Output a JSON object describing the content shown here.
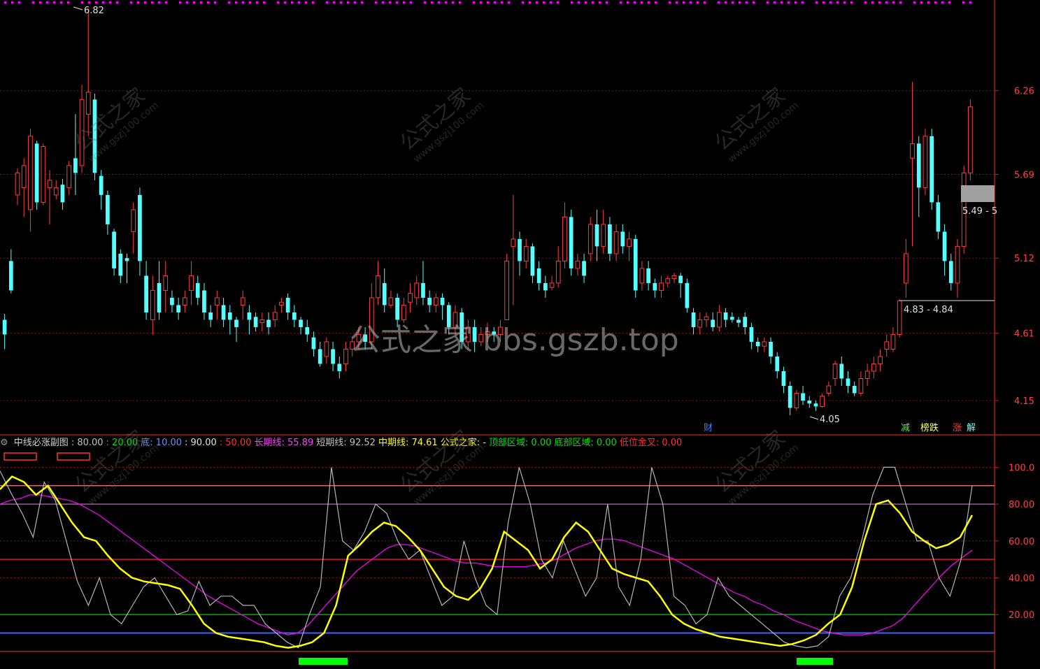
{
  "watermark_main": "公式之家 bbs.gszb.top",
  "watermark_diag": "公式之家",
  "watermark_diag_url": "www.gszj100.com",
  "colors": {
    "up": "#ff3c3c",
    "down": "#54ffff",
    "yellow_line": "#ffff00",
    "magenta_line": "#ff00ff",
    "gray_line": "#b4b4b4",
    "grid_red": "#8a1010"
  },
  "indicator_legend": [
    {
      "text": "中线必涨副图",
      "color": "#d0d0d0"
    },
    {
      "text": ": 80.00",
      "color": "#c0c0c0"
    },
    {
      "text": ": 20.00",
      "color": "#00e000"
    },
    {
      "text": "底: 10.00",
      "color": "#6c8cff"
    },
    {
      "text": ": 90.00",
      "color": "#e0e0e0"
    },
    {
      "text": ": 50.00",
      "color": "#ff3030"
    },
    {
      "text": "长期线: 55.89",
      "color": "#ff40ff"
    },
    {
      "text": "短期线: 92.52",
      "color": "#c0c0c0"
    },
    {
      "text": "中期线: 74.61",
      "color": "#ffff00"
    },
    {
      "text": "公式之家: -",
      "color": "#ffff00"
    },
    {
      "text": "顶部区域: 0.00",
      "color": "#00e000"
    },
    {
      "text": "底部区域: 0.00",
      "color": "#00e000"
    },
    {
      "text": "低位金叉: 0.00",
      "color": "#ff3030"
    }
  ],
  "badges": [
    {
      "text": "财",
      "color": "#4080ff",
      "bg": "#000"
    },
    {
      "text": "减",
      "color": "#40ff40",
      "bg": "#000"
    },
    {
      "text": "榜跌",
      "color": "#ffff60",
      "bg": "#000"
    },
    {
      "text": "涨",
      "color": "#ff4040",
      "bg": "#000"
    },
    {
      "text": "解",
      "color": "#60ffff",
      "bg": "#000"
    }
  ],
  "chart_data": [
    {
      "type": "candlestick",
      "y_ticks": [
        "6.26",
        "5.69",
        "5.12",
        "4.61",
        "4.15"
      ],
      "ylim": [
        3.95,
        6.83
      ],
      "annotations": {
        "high": "6.82",
        "low": "4.05",
        "range_high": "5.49 - 5",
        "range_low": "4.83 - 4.84"
      },
      "candles": [
        [
          4.7,
          4.6,
          4.5,
          4.74
        ],
        [
          5.1,
          4.9,
          4.88,
          5.18
        ],
        [
          5.55,
          5.7,
          5.48,
          5.73
        ],
        [
          5.6,
          5.75,
          5.4,
          5.8
        ],
        [
          5.45,
          5.95,
          5.3,
          6.0
        ],
        [
          5.9,
          5.5,
          5.45,
          5.92
        ],
        [
          5.5,
          5.88,
          5.48,
          5.9
        ],
        [
          5.6,
          5.65,
          5.35,
          5.72
        ],
        [
          5.55,
          5.6,
          5.52,
          5.65
        ],
        [
          5.62,
          5.5,
          5.45,
          5.66
        ],
        [
          5.6,
          5.75,
          5.55,
          5.78
        ],
        [
          5.8,
          5.7,
          5.55,
          6.1
        ],
        [
          5.75,
          6.2,
          5.7,
          6.3
        ],
        [
          6.1,
          6.25,
          5.95,
          6.82
        ],
        [
          6.2,
          5.7,
          5.65,
          6.24
        ],
        [
          5.68,
          5.55,
          5.45,
          5.72
        ],
        [
          5.55,
          5.35,
          5.28,
          5.58
        ],
        [
          5.3,
          5.05,
          5.0,
          5.32
        ],
        [
          5.15,
          5.0,
          4.95,
          5.18
        ],
        [
          5.12,
          5.1,
          4.95,
          5.15
        ],
        [
          5.3,
          5.45,
          5.15,
          5.5
        ],
        [
          5.55,
          5.1,
          5.0,
          5.6
        ],
        [
          5.0,
          4.75,
          4.7,
          5.1
        ],
        [
          4.7,
          4.9,
          4.6,
          5.0
        ],
        [
          4.95,
          4.75,
          4.7,
          5.1
        ],
        [
          4.9,
          5.0,
          4.75,
          5.1
        ],
        [
          4.85,
          4.8,
          4.75,
          4.9
        ],
        [
          4.8,
          4.75,
          4.7,
          4.85
        ],
        [
          4.8,
          4.85,
          4.75,
          4.9
        ],
        [
          4.9,
          5.0,
          4.8,
          5.1
        ],
        [
          4.95,
          4.85,
          4.8,
          5.0
        ],
        [
          4.9,
          4.75,
          4.7,
          4.95
        ],
        [
          4.75,
          4.7,
          4.65,
          4.8
        ],
        [
          4.8,
          4.85,
          4.7,
          4.9
        ],
        [
          4.8,
          4.7,
          4.65,
          4.85
        ],
        [
          4.75,
          4.7,
          4.6,
          4.8
        ],
        [
          4.7,
          4.65,
          4.55,
          4.72
        ],
        [
          4.8,
          4.85,
          4.7,
          4.9
        ],
        [
          4.75,
          4.7,
          4.6,
          4.8
        ],
        [
          4.72,
          4.65,
          4.62,
          4.75
        ],
        [
          4.68,
          4.7,
          4.62,
          4.75
        ],
        [
          4.7,
          4.65,
          4.6,
          4.75
        ],
        [
          4.7,
          4.75,
          4.65,
          4.8
        ],
        [
          4.8,
          4.82,
          4.75,
          4.85
        ],
        [
          4.85,
          4.75,
          4.7,
          4.88
        ],
        [
          4.75,
          4.7,
          4.65,
          4.8
        ],
        [
          4.7,
          4.65,
          4.6,
          4.72
        ],
        [
          4.65,
          4.6,
          4.55,
          4.7
        ],
        [
          4.58,
          4.5,
          4.45,
          4.62
        ],
        [
          4.5,
          4.4,
          4.38,
          4.55
        ],
        [
          4.45,
          4.55,
          4.4,
          4.58
        ],
        [
          4.5,
          4.4,
          4.35,
          4.55
        ],
        [
          4.4,
          4.35,
          4.3,
          4.45
        ],
        [
          4.4,
          4.5,
          4.35,
          4.55
        ],
        [
          4.5,
          4.55,
          4.45,
          4.58
        ],
        [
          4.55,
          4.6,
          4.5,
          4.65
        ],
        [
          4.6,
          4.55,
          4.5,
          4.65
        ],
        [
          4.55,
          4.85,
          4.5,
          4.95
        ],
        [
          4.85,
          5.0,
          4.8,
          5.1
        ],
        [
          4.95,
          4.8,
          4.75,
          5.05
        ],
        [
          4.8,
          4.85,
          4.78,
          4.9
        ],
        [
          4.85,
          4.7,
          4.65,
          4.88
        ],
        [
          4.7,
          4.8,
          4.68,
          4.85
        ],
        [
          4.82,
          4.88,
          4.75,
          4.95
        ],
        [
          4.85,
          4.95,
          4.8,
          5.0
        ],
        [
          4.95,
          4.85,
          4.8,
          5.1
        ],
        [
          4.85,
          4.8,
          4.75,
          4.9
        ],
        [
          4.8,
          4.85,
          4.75,
          4.88
        ],
        [
          4.85,
          4.8,
          4.7,
          4.88
        ],
        [
          4.8,
          4.65,
          4.6,
          4.82
        ],
        [
          4.65,
          4.75,
          4.6,
          4.8
        ],
        [
          4.75,
          4.55,
          4.5,
          4.78
        ],
        [
          4.55,
          4.65,
          4.5,
          4.7
        ],
        [
          4.65,
          4.55,
          4.48,
          4.7
        ],
        [
          4.55,
          4.6,
          4.52,
          4.65
        ],
        [
          4.6,
          4.62,
          4.55,
          4.68
        ],
        [
          4.62,
          4.6,
          4.55,
          4.65
        ],
        [
          4.6,
          4.65,
          4.55,
          4.7
        ],
        [
          4.7,
          5.1,
          4.8,
          5.15
        ],
        [
          5.2,
          5.25,
          4.8,
          5.55
        ],
        [
          5.25,
          5.1,
          5.0,
          5.3
        ],
        [
          5.1,
          5.2,
          5.05,
          5.25
        ],
        [
          5.2,
          5.0,
          4.95,
          5.22
        ],
        [
          5.05,
          4.95,
          4.9,
          5.1
        ],
        [
          4.95,
          4.9,
          4.85,
          5.0
        ],
        [
          4.92,
          4.95,
          4.9,
          5.0
        ],
        [
          4.95,
          5.1,
          4.92,
          5.2
        ],
        [
          5.1,
          5.4,
          5.05,
          5.5
        ],
        [
          5.4,
          5.05,
          5.0,
          5.45
        ],
        [
          5.05,
          5.1,
          5.0,
          5.15
        ],
        [
          5.1,
          5.0,
          4.95,
          5.15
        ],
        [
          5.15,
          5.35,
          5.1,
          5.4
        ],
        [
          5.35,
          5.2,
          5.1,
          5.45
        ],
        [
          5.2,
          5.35,
          5.15,
          5.45
        ],
        [
          5.35,
          5.15,
          5.1,
          5.4
        ],
        [
          5.15,
          5.3,
          5.1,
          5.35
        ],
        [
          5.3,
          5.2,
          5.15,
          5.35
        ],
        [
          5.2,
          5.25,
          5.1,
          5.3
        ],
        [
          5.25,
          4.9,
          4.85,
          5.28
        ],
        [
          4.95,
          5.05,
          4.9,
          5.1
        ],
        [
          5.05,
          4.95,
          4.9,
          5.1
        ],
        [
          4.95,
          4.9,
          4.85,
          4.98
        ],
        [
          4.9,
          4.95,
          4.85,
          5.0
        ],
        [
          4.95,
          4.98,
          4.92,
          5.0
        ],
        [
          4.98,
          5.0,
          4.95,
          5.02
        ],
        [
          5.0,
          4.95,
          4.85,
          5.02
        ],
        [
          4.95,
          4.78,
          4.75,
          4.98
        ],
        [
          4.75,
          4.65,
          4.6,
          4.78
        ],
        [
          4.65,
          4.7,
          4.6,
          4.75
        ],
        [
          4.7,
          4.72,
          4.65,
          4.75
        ],
        [
          4.7,
          4.65,
          4.62,
          4.75
        ],
        [
          4.65,
          4.75,
          4.62,
          4.8
        ],
        [
          4.75,
          4.7,
          4.65,
          4.78
        ],
        [
          4.72,
          4.7,
          4.68,
          4.75
        ],
        [
          4.7,
          4.68,
          4.65,
          4.72
        ],
        [
          4.72,
          4.65,
          4.6,
          4.75
        ],
        [
          4.65,
          4.55,
          4.5,
          4.68
        ],
        [
          4.55,
          4.52,
          4.48,
          4.58
        ],
        [
          4.52,
          4.55,
          4.48,
          4.58
        ],
        [
          4.55,
          4.45,
          4.4,
          4.58
        ],
        [
          4.45,
          4.35,
          4.3,
          4.48
        ],
        [
          4.35,
          4.25,
          4.2,
          4.38
        ],
        [
          4.25,
          4.1,
          4.05,
          4.28
        ],
        [
          4.1,
          4.2,
          4.08,
          4.22
        ],
        [
          4.2,
          4.15,
          4.12,
          4.25
        ],
        [
          4.15,
          4.13,
          4.1,
          4.18
        ],
        [
          4.13,
          4.11,
          4.08,
          4.15
        ],
        [
          4.11,
          4.18,
          4.1,
          4.2
        ],
        [
          4.2,
          4.25,
          4.18,
          4.28
        ],
        [
          4.3,
          4.4,
          4.25,
          4.42
        ],
        [
          4.4,
          4.3,
          4.25,
          4.45
        ],
        [
          4.3,
          4.25,
          4.2,
          4.35
        ],
        [
          4.25,
          4.2,
          4.18,
          4.28
        ],
        [
          4.2,
          4.3,
          4.18,
          4.35
        ],
        [
          4.3,
          4.35,
          4.25,
          4.4
        ],
        [
          4.35,
          4.4,
          4.3,
          4.45
        ],
        [
          4.4,
          4.45,
          4.35,
          4.5
        ],
        [
          4.5,
          4.55,
          4.45,
          4.6
        ],
        [
          4.5,
          4.6,
          4.48,
          4.65
        ],
        [
          4.6,
          4.83,
          4.58,
          4.84
        ],
        [
          4.95,
          5.15,
          4.85,
          5.25
        ],
        [
          5.8,
          5.9,
          5.2,
          6.32
        ],
        [
          5.9,
          5.6,
          5.4,
          5.95
        ],
        [
          5.6,
          5.95,
          5.55,
          6.0
        ],
        [
          5.95,
          5.5,
          5.45,
          6.0
        ],
        [
          5.5,
          5.3,
          5.25,
          5.55
        ],
        [
          5.3,
          5.1,
          5.0,
          5.35
        ],
        [
          5.1,
          4.95,
          4.9,
          5.15
        ],
        [
          4.95,
          5.2,
          4.85,
          5.25
        ],
        [
          5.2,
          5.7,
          5.15,
          5.75
        ],
        [
          5.7,
          6.15,
          5.65,
          6.2
        ]
      ]
    },
    {
      "type": "line",
      "y_ticks": [
        "100.0",
        "80.00",
        "60.00",
        "40.00",
        "20.00"
      ],
      "ylim": [
        -5,
        107
      ],
      "levels": [
        {
          "value": 90,
          "color": "#ff8080"
        },
        {
          "value": 80,
          "color": "#c060c0"
        },
        {
          "value": 50,
          "color": "#ff2020"
        },
        {
          "value": 20,
          "color": "#00d000"
        },
        {
          "value": 10,
          "color": "#4060ff"
        },
        {
          "value": 0,
          "color": "#ff2020"
        }
      ],
      "series": [
        {
          "name": "长期线",
          "values": [
            80,
            82,
            83,
            85,
            85,
            84,
            83,
            82,
            80,
            77,
            74,
            70,
            66,
            62,
            58,
            54,
            50,
            46,
            42,
            38,
            34,
            30,
            27,
            24,
            21,
            18,
            15,
            13,
            11,
            9,
            10,
            14,
            20,
            26,
            32,
            38,
            44,
            48,
            52,
            56,
            58,
            58,
            57,
            55,
            53,
            51,
            49,
            48,
            48,
            47,
            46,
            46,
            46,
            46,
            47,
            48,
            50,
            53,
            56,
            58,
            60,
            61,
            61,
            60,
            58,
            56,
            54,
            52,
            50,
            47,
            44,
            41,
            38,
            35,
            32,
            30,
            27,
            25,
            22,
            20,
            17,
            15,
            13,
            11,
            10,
            9,
            9,
            9,
            10,
            12,
            14,
            18,
            24,
            30,
            36,
            42,
            47,
            51,
            55
          ]
        },
        {
          "name": "短期线",
          "values": [
            98,
            86,
            75,
            62,
            92,
            82,
            60,
            38,
            25,
            40,
            20,
            15,
            25,
            35,
            40,
            30,
            20,
            22,
            38,
            25,
            30,
            30,
            25,
            25,
            15,
            10,
            5,
            2,
            20,
            35,
            100,
            60,
            55,
            65,
            80,
            75,
            60,
            50,
            55,
            40,
            25,
            30,
            60,
            40,
            25,
            20,
            70,
            100,
            80,
            50,
            40,
            60,
            45,
            30,
            40,
            80,
            35,
            25,
            50,
            100,
            80,
            30,
            25,
            15,
            20,
            40,
            30,
            25,
            20,
            15,
            10,
            5,
            3,
            2,
            3,
            8,
            30,
            40,
            60,
            85,
            100,
            100,
            80,
            60,
            60,
            40,
            30,
            50,
            90
          ]
        },
        {
          "name": "中期线",
          "values": [
            88,
            95,
            92,
            85,
            90,
            80,
            70,
            62,
            60,
            52,
            45,
            40,
            38,
            37,
            36,
            34,
            25,
            15,
            10,
            8,
            7,
            6,
            5,
            3,
            2,
            3,
            5,
            10,
            25,
            52,
            58,
            65,
            70,
            68,
            62,
            55,
            45,
            35,
            30,
            28,
            34,
            45,
            65,
            60,
            55,
            45,
            50,
            62,
            70,
            65,
            55,
            45,
            42,
            40,
            38,
            30,
            20,
            15,
            12,
            10,
            8,
            7,
            6,
            5,
            4,
            3,
            4,
            6,
            9,
            15,
            20,
            35,
            60,
            80,
            82,
            75,
            65,
            60,
            56,
            58,
            62,
            74
          ]
        }
      ]
    }
  ]
}
